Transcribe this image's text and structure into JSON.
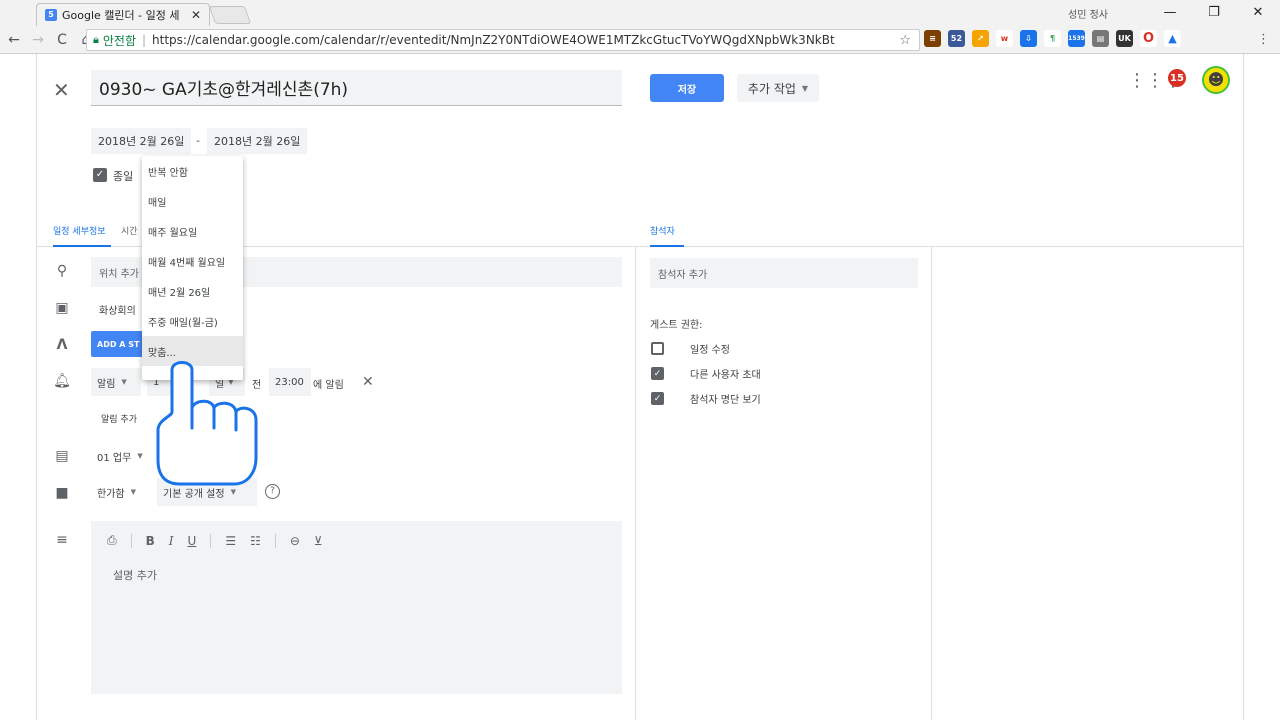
{
  "browser": {
    "tab_title": "Google 캘린더 - 일정 세",
    "tab_favicon": "5",
    "user_label": "성민 정사",
    "secure_label": "안전함",
    "url": "https://calendar.google.com/calendar/r/eventedit/NmJnZ2Y0NTdiOWE4OWE1MTZkcGtucTVoYWQgdXNpbWk3NkBt",
    "ext_badge_52": "52",
    "ext_badge_1539": "1539",
    "ext_badge_uk": "UK"
  },
  "event": {
    "title": "0930~ GA기초@한겨레신촌(7h)",
    "start_date": "2018년 2월 26일",
    "date_dash": "-",
    "end_date": "2018년 2월 26일",
    "allday_label": "종일"
  },
  "actions": {
    "save_label": "저장",
    "more_label": "추가 작업",
    "notification_count": "15"
  },
  "tabs": {
    "details_label": "일정 세부정보",
    "time_label": "시간",
    "guests_label": "참석자"
  },
  "fields": {
    "location_placeholder": "위치 추가",
    "video_label": "화상회의",
    "add_step_label": "ADD A ST",
    "alert_type": "알림",
    "alert_amount": "1",
    "alert_unit": "일",
    "alert_before": "전",
    "alert_time": "23:00",
    "alert_suffix": "에 알림",
    "add_alert_label": "알림 추가",
    "calendar_label": "01 업무",
    "busy_label": "한가함",
    "visibility_label": "기본 공개 설정",
    "help_icon": "?",
    "description_placeholder": "설명 추가"
  },
  "format_bar": [
    "B",
    "I",
    "U"
  ],
  "guests": {
    "add_placeholder": "참석자 추가",
    "permissions_title": "게스트 권한:",
    "permissions": [
      {
        "label": "일정 수정",
        "checked": false
      },
      {
        "label": "다른 사용자 초대",
        "checked": true
      },
      {
        "label": "참석자 명단 보기",
        "checked": true
      }
    ]
  },
  "repeat_menu": {
    "options": [
      "반복 안함",
      "매일",
      "매주 월요일",
      "매월 4번째 월요일",
      "매년 2월 26일",
      "주중 매일(월-금)",
      "맞춤..."
    ],
    "hovered_index": 6
  }
}
